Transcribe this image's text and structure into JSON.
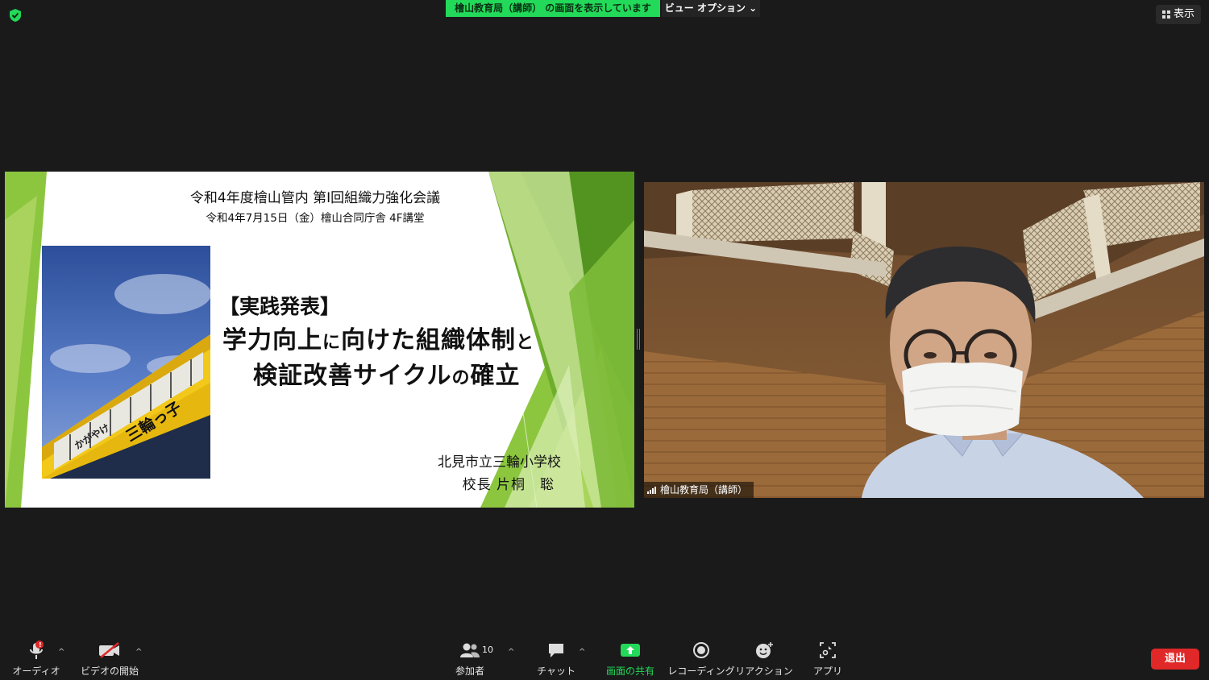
{
  "top_bar": {
    "share_banner": "檜山教育局（講師） の画面を表示しています",
    "view_options": "ビュー オプション ⌄",
    "display_button": "表示"
  },
  "slide": {
    "header_line1": "令和4年度檜山管内 第Ⅰ回組織力強化会議",
    "header_line2": "令和4年7月15日（金）檜山合同庁舎 4F講堂",
    "tag": "【実践発表】",
    "title_line1_a": "学力向上",
    "title_line1_b": "に",
    "title_line1_c": "向けた組織体制",
    "title_line1_d": "と",
    "title_line2_a": "検証改善サイクル",
    "title_line2_b": "の",
    "title_line2_c": "確立",
    "school": "北見市立三輪小学校",
    "principal": "校長 片桐　聡",
    "photo_sign_left": "かがやけ",
    "photo_sign_right": "三輪っ子"
  },
  "video": {
    "participant_name": "檜山教育局（講師）"
  },
  "toolbar": {
    "audio_label": "オーディオ",
    "audio_badge": "!",
    "video_label": "ビデオの開始",
    "participants_label": "参加者",
    "participants_count": "10",
    "chat_label": "チャット",
    "share_label": "画面の共有",
    "record_label": "レコーディング",
    "reaction_label": "リアクション",
    "apps_label": "アプリ",
    "end_label": "退出",
    "caret": "^"
  },
  "colors": {
    "background": "#1a1a1a",
    "share_green": "#23d959",
    "end_red": "#e02828",
    "slide_green": "#8cc63f"
  }
}
